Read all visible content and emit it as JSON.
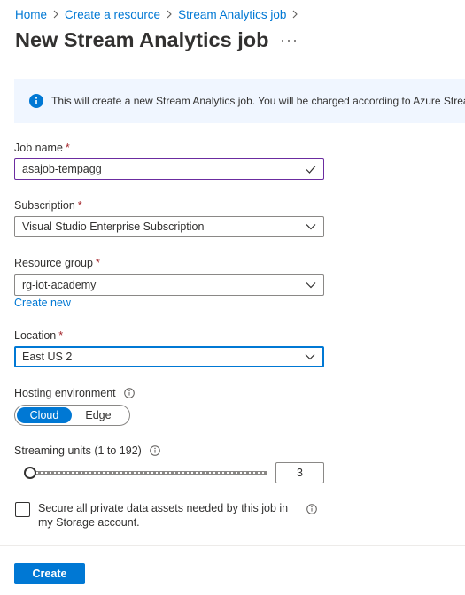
{
  "breadcrumb": {
    "items": [
      "Home",
      "Create a resource",
      "Stream Analytics job"
    ]
  },
  "page": {
    "title": "New Stream Analytics job"
  },
  "info_banner": {
    "text": "This will create a new Stream Analytics job. You will be charged according to Azure Stream Analytics pricing."
  },
  "form": {
    "job_name": {
      "label": "Job name",
      "required_mark": "*",
      "value": "asajob-tempagg",
      "status": "valid"
    },
    "subscription": {
      "label": "Subscription",
      "required_mark": "*",
      "value": "Visual Studio Enterprise Subscription"
    },
    "resource_group": {
      "label": "Resource group",
      "required_mark": "*",
      "value": "rg-iot-academy",
      "create_new_link": "Create new"
    },
    "location": {
      "label": "Location",
      "required_mark": "*",
      "value": "East US 2"
    },
    "hosting": {
      "label": "Hosting environment",
      "options": [
        "Cloud",
        "Edge"
      ],
      "selected": "Cloud"
    },
    "streaming_units": {
      "label": "Streaming units (1 to 192)",
      "value": "3",
      "min": 1,
      "max": 192
    },
    "secure_assets": {
      "label": "Secure all private data assets needed by this job in my Storage account.",
      "checked": false
    }
  },
  "actions": {
    "create_label": "Create"
  },
  "colors": {
    "accent": "#0078d4",
    "valid_border": "#6b2ca0",
    "required": "#a4262c",
    "banner_bg": "#f0f6ff"
  }
}
